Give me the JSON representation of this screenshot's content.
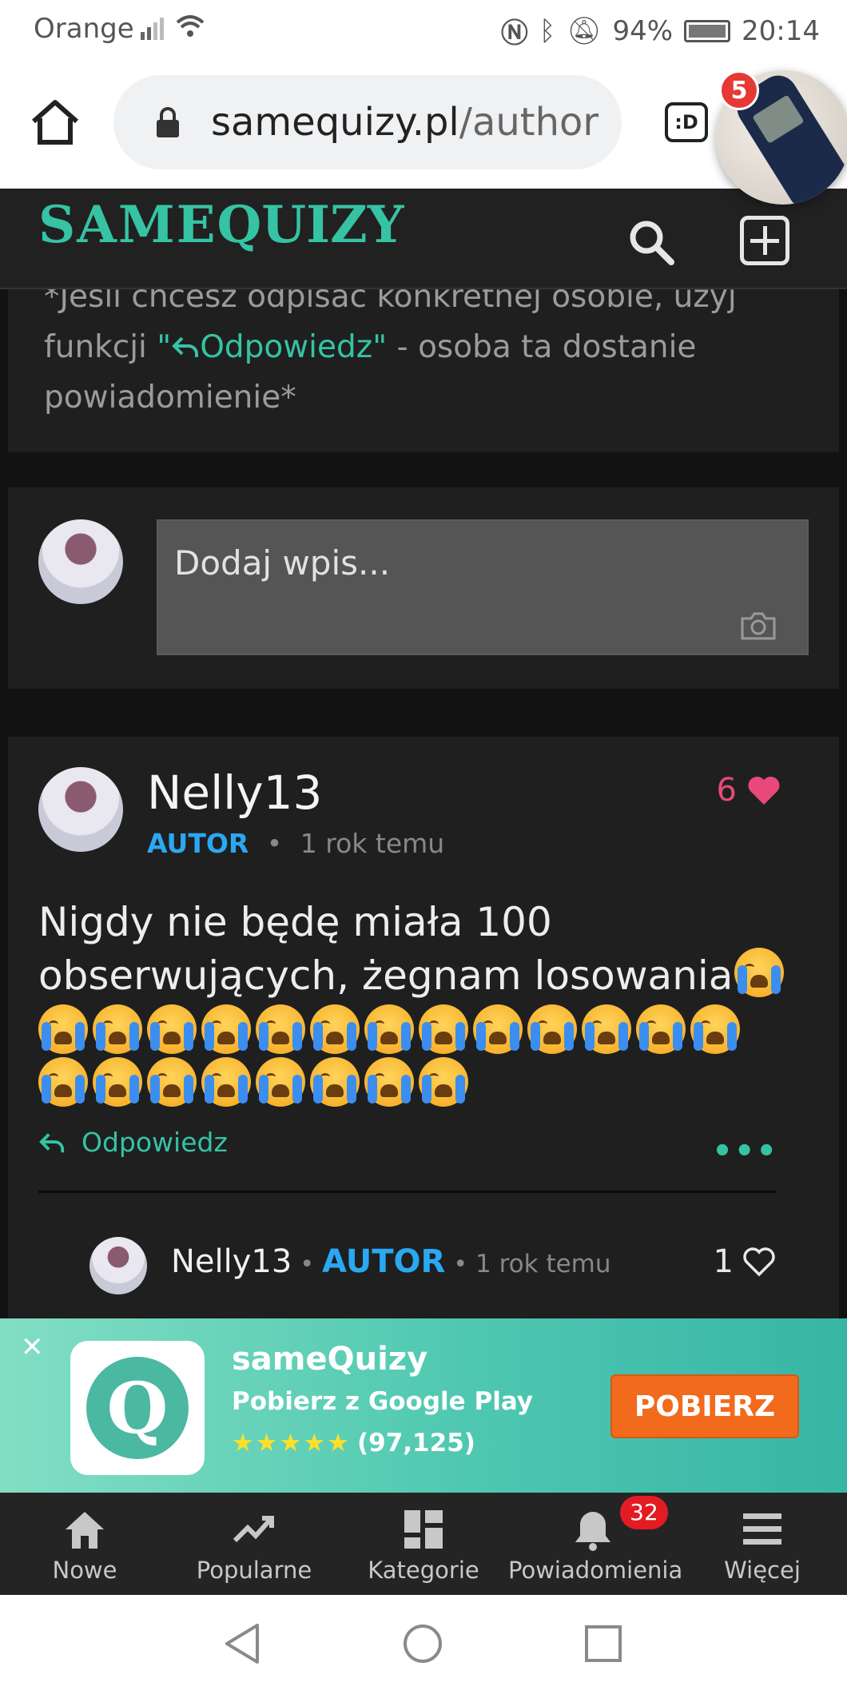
{
  "status_bar": {
    "carrier": "Orange",
    "battery": "94%",
    "time": "20:14"
  },
  "browser": {
    "url_domain": "samequizy.pl",
    "url_path": "/author",
    "tab_label": ":D",
    "bubble_badge": "5"
  },
  "site": {
    "logo_part1": "SAME",
    "logo_part2": "QUIZY"
  },
  "notice": {
    "text_before": "*Jeśli chcesz odpisać konkretnej osobie, użyj funkcji ",
    "quote_open": "\"",
    "highlight": "Odpowiedz",
    "quote_close": "\"",
    "text_after": " - osoba ta dostanie powiadomienie*"
  },
  "entry": {
    "placeholder": "Dodaj wpis..."
  },
  "comment": {
    "author": "Nelly13",
    "badge": "AUTOR",
    "separator": "•",
    "time": "1 rok temu",
    "likes": "6",
    "text": "Nigdy nie będę miała 100 obserwujących, żegnam losowania",
    "reply_label": "Odpowiedz",
    "more_label": "•••",
    "reply": {
      "author": "Nelly13",
      "badge": "AUTOR",
      "separator": "•",
      "time": "1 rok temu",
      "likes": "1"
    }
  },
  "app_banner": {
    "close": "✕",
    "title": "sameQuizy",
    "subtitle": "Pobierz z Google Play",
    "stars": "★★★★★",
    "rating_count": "(97,125)",
    "button": "POBIERZ"
  },
  "bottom_nav": {
    "items": [
      {
        "label": "Nowe"
      },
      {
        "label": "Popularne"
      },
      {
        "label": "Kategorie"
      },
      {
        "label": "Powiadomienia",
        "badge": "32"
      },
      {
        "label": "Więcej"
      }
    ]
  },
  "colors": {
    "accent": "#35c3a4",
    "autor": "#2aa8f2",
    "like": "#e8497a",
    "cta": "#f26a1b"
  }
}
